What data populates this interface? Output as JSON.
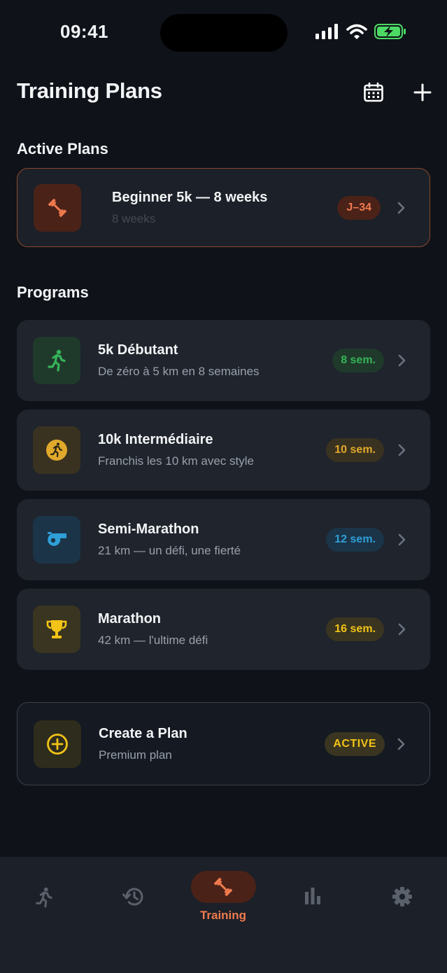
{
  "status_bar": {
    "time": "09:41"
  },
  "header": {
    "title": "Training Plans"
  },
  "active_section": {
    "title": "Active Plans",
    "plan": {
      "title": "Beginner 5k — 8 weeks",
      "subtitle": "8 weeks",
      "badge": "J–34",
      "icon": "dumbbell-icon"
    }
  },
  "programs_section": {
    "title": "Programs",
    "items": [
      {
        "title": "5k Débutant",
        "subtitle": "De zéro à 5 km en 8 semaines",
        "badge": "8 sem.",
        "icon": "runner-icon",
        "accent": "#35b45a"
      },
      {
        "title": "10k Intermédiaire",
        "subtitle": "Franchis les 10 km avec style",
        "badge": "10 sem.",
        "icon": "runner-circle-icon",
        "accent": "#e0a92b"
      },
      {
        "title": "Semi-Marathon",
        "subtitle": "21 km — un défi, une fierté",
        "badge": "12 sem.",
        "icon": "whistle-icon",
        "accent": "#2f9fd8"
      },
      {
        "title": "Marathon",
        "subtitle": "42 km — l'ultime défi",
        "badge": "16 sem.",
        "icon": "trophy-icon",
        "accent": "#f2c318"
      }
    ]
  },
  "create_plan": {
    "title": "Create a Plan",
    "subtitle": "Premium plan",
    "badge": "ACTIVE",
    "icon": "plus-circle-icon",
    "accent": "#f2c318"
  },
  "tab_bar": {
    "items": [
      {
        "icon": "runner-icon",
        "label": ""
      },
      {
        "icon": "history-icon",
        "label": ""
      },
      {
        "icon": "dumbbell-icon",
        "label": "Training",
        "selected": true
      },
      {
        "icon": "bar-chart-icon",
        "label": ""
      },
      {
        "icon": "gear-icon",
        "label": ""
      }
    ]
  },
  "colors": {
    "background": "#0f1319",
    "card": "#1f242d",
    "accent": "#f07a4e",
    "green": "#35b45a",
    "amber": "#e0a92b",
    "blue": "#2f9fd8",
    "yellow": "#f2c318"
  }
}
